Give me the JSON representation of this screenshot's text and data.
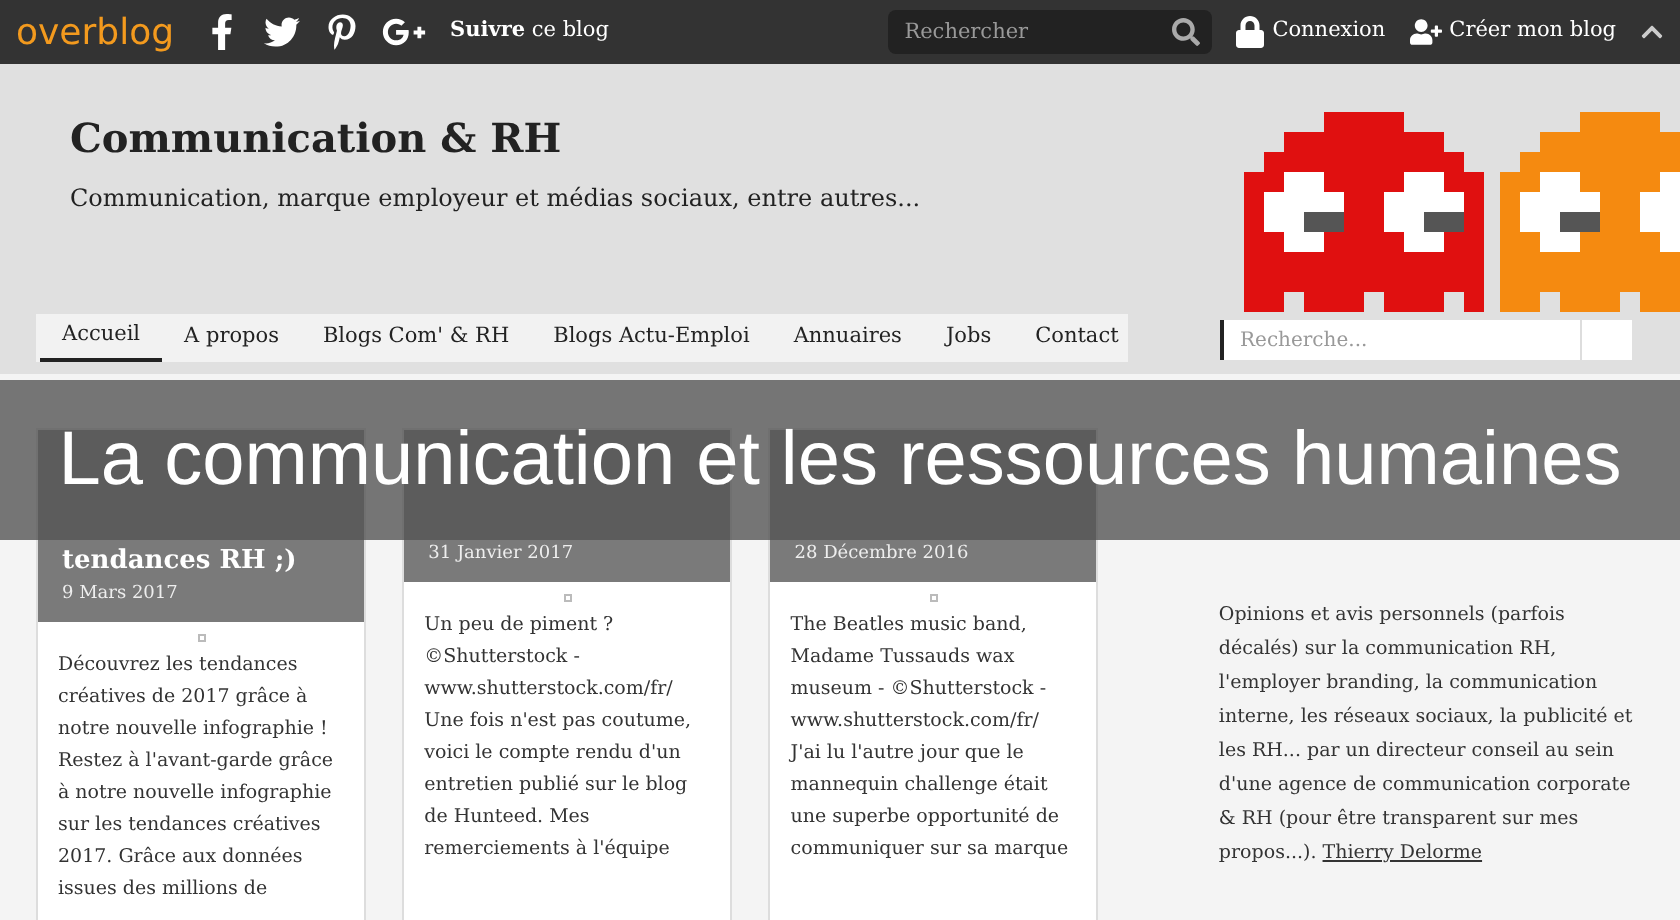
{
  "topbar": {
    "logo": "overblog",
    "follow_bold": "Suivre",
    "follow_rest": "ce blog",
    "search": {
      "placeholder": "Rechercher"
    },
    "login": "Connexion",
    "create": "Créer mon blog"
  },
  "header": {
    "title": "Communication & RH",
    "subtitle": "Communication, marque employeur et médias sociaux, entre autres..."
  },
  "nav": [
    {
      "label": "Accueil",
      "selected": true
    },
    {
      "label": "A propos",
      "selected": false
    },
    {
      "label": "Blogs Com' & RH",
      "selected": false
    },
    {
      "label": "Blogs Actu-Emploi",
      "selected": false
    },
    {
      "label": "Annuaires",
      "selected": false
    },
    {
      "label": "Jobs",
      "selected": false
    },
    {
      "label": "Contact",
      "selected": false
    }
  ],
  "sidebar_search": {
    "placeholder": "Recherche..."
  },
  "banner": "La communication et les ressources humaines",
  "posts": [
    {
      "title_lines": [
        "tendances RH ;)"
      ],
      "date": "9 Mars 2017",
      "lines": [
        "Découvrez les tendances",
        "créatives de 2017 grâce à",
        "notre nouvelle infographie !",
        "Restez à l'avant-garde grâce",
        "à notre nouvelle infographie",
        "sur les tendances créatives",
        "2017. Grâce aux données",
        "issues des millions de"
      ]
    },
    {
      "date": "31 Janvier 2017",
      "lines": [
        "Un peu de piment ?",
        "©Shutterstock -",
        "www.shutterstock.com/fr/",
        "Une fois n'est pas coutume,",
        "voici le compte rendu d'un",
        "entretien publié sur le blog",
        "de Hunteed. Mes",
        "remerciements à l'équipe"
      ]
    },
    {
      "date": "28 Décembre 2016",
      "lines": [
        "The Beatles music band,",
        "Madame Tussauds wax",
        "museum - ©Shutterstock -",
        "www.shutterstock.com/fr/",
        "J'ai lu l'autre jour que le",
        "mannequin challenge était",
        "une superbe opportunité de",
        "communiquer sur sa marque"
      ]
    }
  ],
  "sidebar": {
    "text": "Opinions et avis personnels (parfois décalés) sur la communication RH, l'employer branding, la communication interne, les réseaux sociaux, la publicité et les RH... par un directeur conseil au sein d'une agence de communication corporate & RH (pour être transparent sur mes propos...).",
    "link": "Thierry Delorme"
  }
}
